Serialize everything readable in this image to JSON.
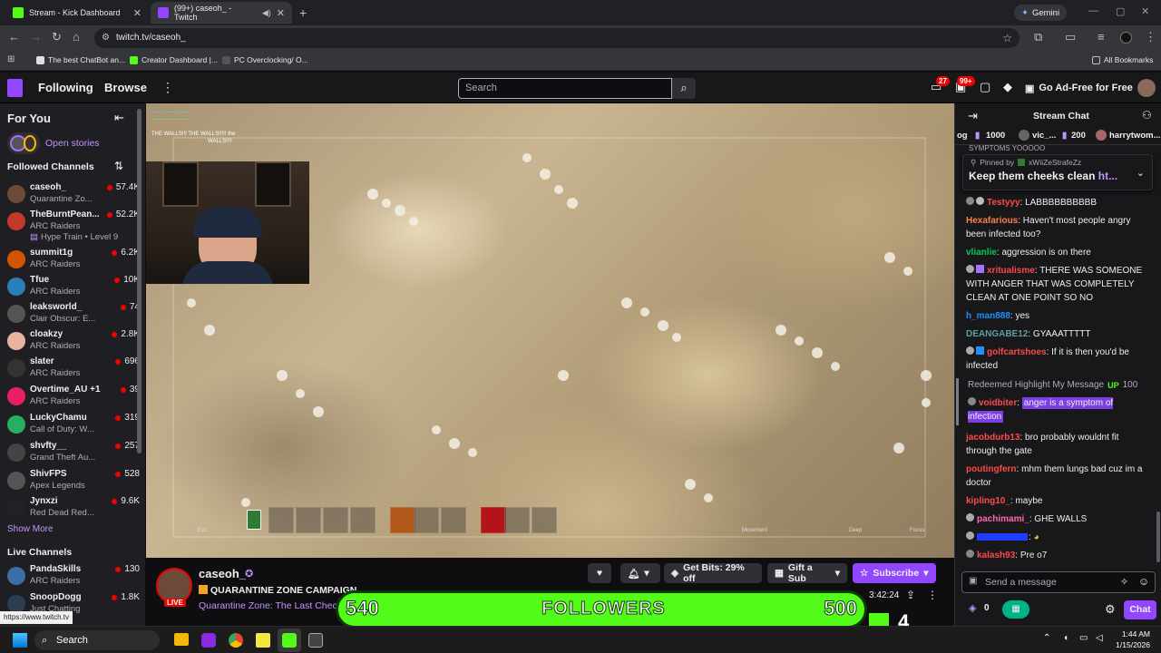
{
  "browser": {
    "tabs": [
      {
        "title": "Stream - Kick Dashboard",
        "active": false
      },
      {
        "title": "(99+) caseoh_ - Twitch",
        "active": true
      }
    ],
    "profile_label": "Gemini",
    "url": "twitch.tv/caseoh_",
    "bookmarks": [
      "The best ChatBot an...",
      "Creator Dashboard |...",
      "PC Overclocking/ O..."
    ],
    "all_bookmarks": "All Bookmarks"
  },
  "topnav": {
    "following": "Following",
    "browse": "Browse",
    "search_placeholder": "Search",
    "notif_badge_1": "27",
    "notif_badge_2": "99+",
    "ad_free": "Go Ad-Free for Free"
  },
  "sidebar": {
    "for_you": "For You",
    "open_stories": "Open stories",
    "followed_channels": "Followed Channels",
    "channels": [
      {
        "name": "caseoh_",
        "game": "Quarantine Zo...",
        "viewers": "57.4K",
        "color": "#6b4a3a"
      },
      {
        "name": "TheBurntPean...",
        "game": "ARC Raiders",
        "viewers": "52.2K",
        "color": "#c0392b"
      },
      {
        "name": "",
        "game": "Hype Train • Level 9",
        "viewers": "",
        "color": ""
      },
      {
        "name": "summit1g",
        "game": "ARC Raiders",
        "viewers": "6.2K",
        "color": "#d35400"
      },
      {
        "name": "Tfue",
        "game": "ARC Raiders",
        "viewers": "10K",
        "color": "#2980b9"
      },
      {
        "name": "leaksworld_",
        "game": "Clair Obscur: E...",
        "viewers": "74",
        "color": "#555555"
      },
      {
        "name": "cloakzy",
        "game": "ARC Raiders",
        "viewers": "2.8K",
        "color": "#e8b4a0"
      },
      {
        "name": "slater",
        "game": "ARC Raiders",
        "viewers": "696",
        "color": "#333333"
      },
      {
        "name": "Overtime_AU +1",
        "game": "ARC Raiders",
        "viewers": "39",
        "color": "#e91e63"
      },
      {
        "name": "LuckyChamu",
        "game": "Call of Duty: W...",
        "viewers": "319",
        "color": "#27ae60"
      },
      {
        "name": "shvfty__",
        "game": "Grand Theft Au...",
        "viewers": "257",
        "color": "#444444"
      },
      {
        "name": "ShivFPS",
        "game": "Apex Legends",
        "viewers": "528",
        "color": "#555555"
      },
      {
        "name": "Jynxzi",
        "game": "Red Dead Red...",
        "viewers": "9.6K",
        "color": "#222222"
      }
    ],
    "show_more": "Show More",
    "live_channels": "Live Channels",
    "live": [
      {
        "name": "PandaSkills",
        "game": "ARC Raiders",
        "viewers": "130",
        "color": "#3a6ea5"
      },
      {
        "name": "SnoopDogg",
        "game": "Just Chatting",
        "viewers": "1.8K",
        "color": "#2c3e50"
      }
    ],
    "status_url": "https://www.twitch.tv"
  },
  "video": {
    "overlay_lines": [
      "THE WALLS!!! THE WALLS!!!!! the",
      "WALLS!!!!"
    ],
    "hud_labels": [
      "Exit",
      "Movement",
      "Deep",
      "Focus"
    ]
  },
  "stream_info": {
    "channel": "caseoh_",
    "title": "QUARANTINE ZONE CAMPAIGN",
    "game": "Quarantine Zone: The Last Check",
    "live": "LIVE",
    "get_bits": "Get Bits: 29% off",
    "gift_sub": "Gift a Sub",
    "subscribe": "Subscribe",
    "uptime": "3:42:24",
    "viewers_partial": "500"
  },
  "followers_overlay": {
    "current": "540",
    "label": "FOLLOWERS",
    "goal": "500",
    "kick_count": "4"
  },
  "chat": {
    "header": "Stream Chat",
    "gifters": [
      {
        "name": "1000"
      },
      {
        "name": "vic_..."
      },
      {
        "name": "200"
      },
      {
        "name": "harrytwom..."
      }
    ],
    "pinned_by_prefix": "Pinned by",
    "pinned_by": "xWiiZeStrafeZz",
    "pinned_text": "Keep them cheeks clean",
    "pinned_link": "ht...",
    "top_partial": "SYMPTOMS YOOOOO",
    "messages": [
      {
        "user": "Testyyy",
        "text": ": LABBBBBBBBBB",
        "color": "#ff4a4a"
      },
      {
        "user": "Hexafarious",
        "text": ": Haven't most people angry been infected too?",
        "color": "#ff7f50"
      },
      {
        "user": "vlianlie",
        "text": ": aggression is on there",
        "color": "#00c853"
      },
      {
        "user": "xritualisme",
        "text": ": THERE WAS SOMEONE WITH ANGER THAT WAS COMPLETELY CLEAN AT ONE POINT SO NO",
        "color": "#ff4a4a"
      },
      {
        "user": "h_man888",
        "text": ": yes",
        "color": "#1e90ff"
      },
      {
        "user": "DEANGABE12",
        "text": ": GYAAATTTTT",
        "color": "#5f9ea0"
      },
      {
        "user": "golfcartshoes",
        "text": ": If it is then you'd be infected",
        "color": "#ff4a4a"
      }
    ],
    "highlight": {
      "label": "Redeemed Highlight My Message",
      "cost": "100",
      "user": "voidbiter",
      "text": "anger is a symptom of infection"
    },
    "messages2": [
      {
        "user": "jacobdurb13",
        "text": ": bro probably wouldnt fit through the gate",
        "color": "#ff4a4a"
      },
      {
        "user": "poutingfern",
        "text": ": mhm them lungs bad cuz im a doctor",
        "color": "#ff4a4a"
      },
      {
        "user": "kipling10_",
        "text": ": maybe",
        "color": "#ff4a4a"
      },
      {
        "user": "pachimami_",
        "text": ": GHE WALLS",
        "color": "#ff69b4"
      },
      {
        "user": "",
        "text": ": ",
        "color": "#1e3cff"
      },
      {
        "user": "kalash93",
        "text": ": Pre o7",
        "color": "#ff4a4a"
      }
    ],
    "input_placeholder": "Send a message",
    "points": "0",
    "chat_button": "Chat"
  },
  "taskbar": {
    "search": "Search",
    "time": "1:44 AM",
    "date": "1/15/2026"
  }
}
